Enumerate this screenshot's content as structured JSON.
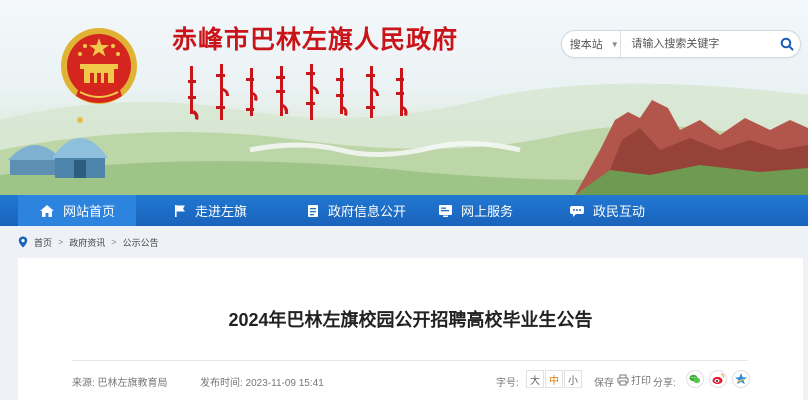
{
  "header": {
    "site_title": "赤峰市巴林左旗人民政府",
    "mongolian_title": "ᠪᠠᠭᠠᠷᠢᠨ ᠵᠡᠭᠦᠨ ᠬᠣᠰᠢᠭᠤ",
    "search": {
      "scope_label": "搜本站",
      "placeholder": "请输入搜索关键字"
    }
  },
  "nav": {
    "items": [
      {
        "label": "网站首页",
        "icon": "home-icon",
        "active": true
      },
      {
        "label": "走进左旗",
        "icon": "flag-icon",
        "active": false
      },
      {
        "label": "政府信息公开",
        "icon": "document-icon",
        "active": false
      },
      {
        "label": "网上服务",
        "icon": "service-icon",
        "active": false
      },
      {
        "label": "政民互动",
        "icon": "chat-icon",
        "active": false
      }
    ]
  },
  "breadcrumb": {
    "items": [
      "首页",
      "政府资讯",
      "公示公告"
    ],
    "separator": ">"
  },
  "article": {
    "title": "2024年巴林左旗校园公开招聘高校毕业生公告",
    "source": "来源: 巴林左旗教育局",
    "date": "发布时间: 2023-11-09 15:41",
    "font_size_label": "字号:",
    "font_sizes": [
      "大",
      "中",
      "小"
    ],
    "active_font_size": "中",
    "save_label": "保存",
    "print_label": "打印",
    "share_label": "分享:",
    "share_icons": [
      "wechat-icon",
      "weibo-icon",
      "qzone-icon"
    ]
  },
  "colors": {
    "nav_blue": "#1a63bb",
    "title_red": "#c9141a",
    "accent_orange": "#e07b00"
  }
}
